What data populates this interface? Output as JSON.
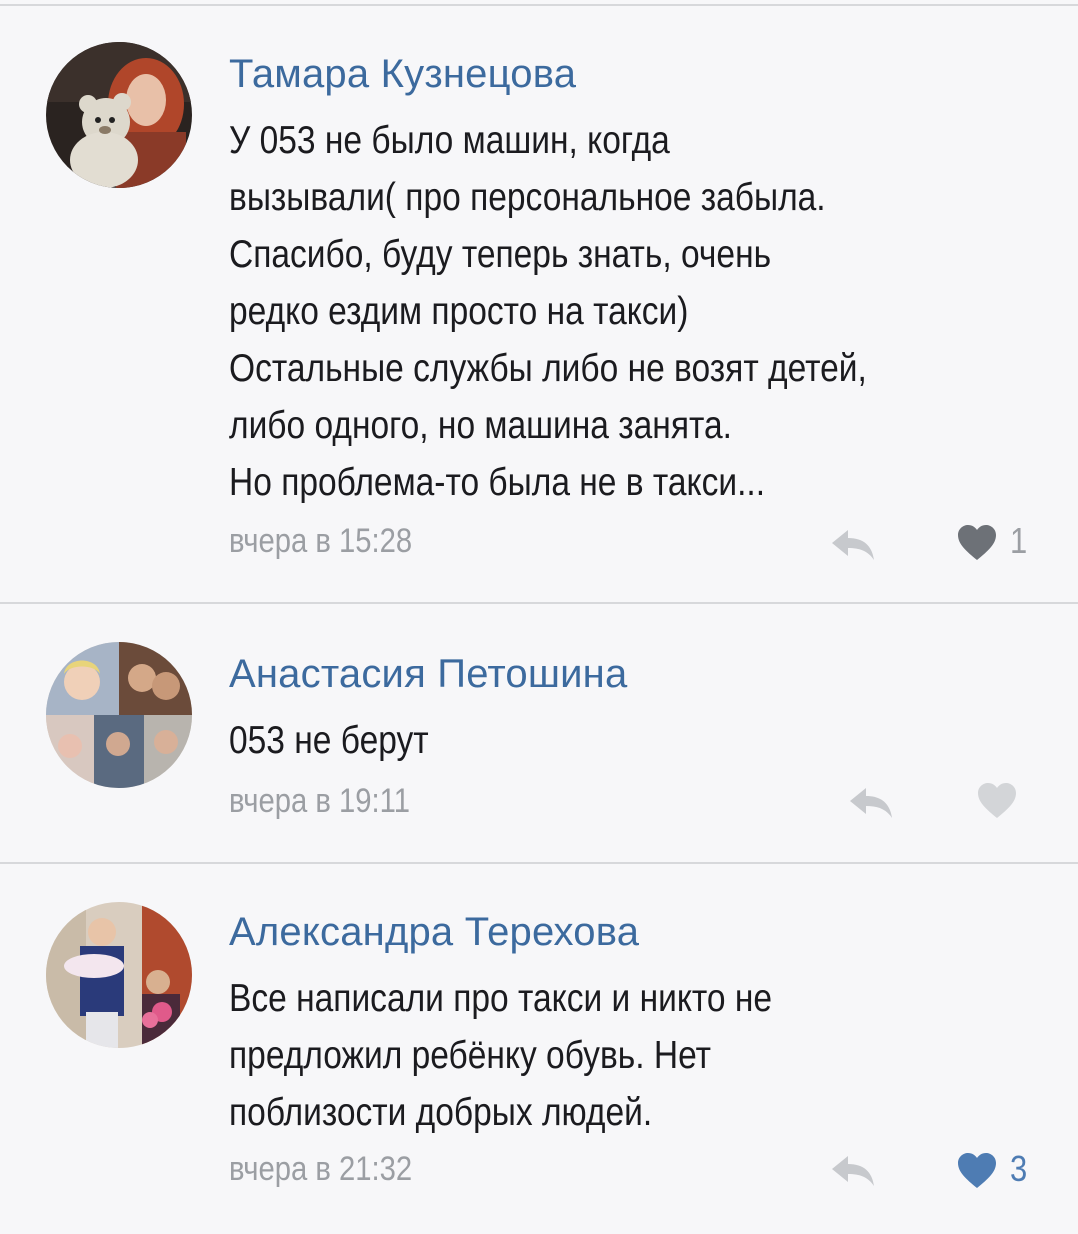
{
  "comments": [
    {
      "author": "Тамара Кузнецова",
      "text_lines": [
        "У 053 не было машин, когда",
        "вызывали( про персональное забыла.",
        "Спасибо, буду теперь знать, очень",
        "редко ездим просто на такси)",
        "Остальные службы либо не возят детей,",
        "либо одного, но машина занята.",
        "Но проблема-то была не в такси..."
      ],
      "time": "вчера в 15:28",
      "likes": "1",
      "liked": false,
      "avatar_icon": "avatar-photo-woman-with-teddy-bear"
    },
    {
      "author": "Анастасия Петошина",
      "text_lines": [
        "053 не берут"
      ],
      "time": "вчера в 19:11",
      "likes": "",
      "liked": false,
      "avatar_icon": "avatar-photo-collage"
    },
    {
      "author": "Александра Терехова",
      "text_lines": [
        "Все написали про такси и никто не",
        "предложил ребёнку обувь. Нет",
        "поблизости добрых людей."
      ],
      "time": "вчера в 21:32",
      "likes": "3",
      "liked": true,
      "avatar_icon": "avatar-photo-family"
    }
  ],
  "colors": {
    "author": "#3c6a9e",
    "text": "#1b1b1f",
    "meta": "#9b9ea3",
    "like_active": "#4e7cb3",
    "like_inactive": "#6d7177",
    "background": "#f7f7f9",
    "divider": "#d7d8db"
  }
}
